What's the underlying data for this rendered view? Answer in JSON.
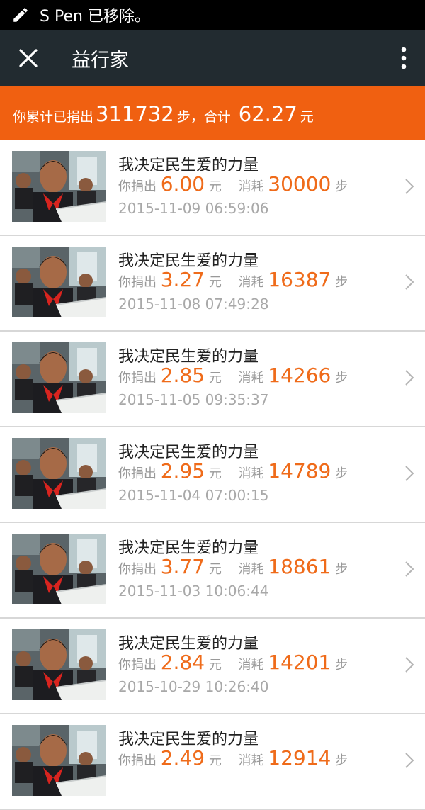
{
  "status": {
    "text": "S Pen 已移除。"
  },
  "toolbar": {
    "title": "益行家"
  },
  "banner": {
    "prefix": "你累计已捐出",
    "steps": "311732",
    "mid": "步，合计",
    "amount": "62.27",
    "unit": "元"
  },
  "labels": {
    "donate": "你捐出",
    "yuan": "元",
    "consume": "消耗",
    "step": "步"
  },
  "items": [
    {
      "title": "我决定民生爱的力量",
      "amount": "6.00",
      "steps": "30000",
      "date": "2015-11-09 06:59:06"
    },
    {
      "title": "我决定民生爱的力量",
      "amount": "3.27",
      "steps": "16387",
      "date": "2015-11-08 07:49:28"
    },
    {
      "title": "我决定民生爱的力量",
      "amount": "2.85",
      "steps": "14266",
      "date": "2015-11-05 09:35:37"
    },
    {
      "title": "我决定民生爱的力量",
      "amount": "2.95",
      "steps": "14789",
      "date": "2015-11-04 07:00:15"
    },
    {
      "title": "我决定民生爱的力量",
      "amount": "3.77",
      "steps": "18861",
      "date": "2015-11-03 10:06:44"
    },
    {
      "title": "我决定民生爱的力量",
      "amount": "2.84",
      "steps": "14201",
      "date": "2015-10-29 10:26:40"
    },
    {
      "title": "我决定民生爱的力量",
      "amount": "2.49",
      "steps": "12914",
      "date": ""
    }
  ]
}
